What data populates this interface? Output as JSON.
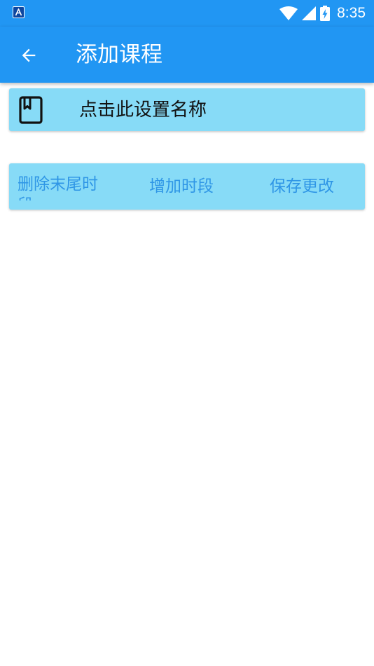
{
  "status_bar": {
    "time": "8:35",
    "icons": [
      "app-notification-icon",
      "wifi-icon",
      "signal-icon",
      "battery-charging-icon"
    ]
  },
  "app_bar": {
    "title": "添加课程",
    "back_icon": "arrow-back-icon"
  },
  "course_name": {
    "icon": "book-icon",
    "label": "点击此设置名称"
  },
  "actions": {
    "delete_last_period": "删除末尾时段",
    "add_period": "增加时段",
    "save_changes": "保存更改"
  },
  "colors": {
    "primary": "#2196f3",
    "card": "#87dbf7",
    "action_text": "#2f96e6",
    "name_text": "#111111"
  }
}
